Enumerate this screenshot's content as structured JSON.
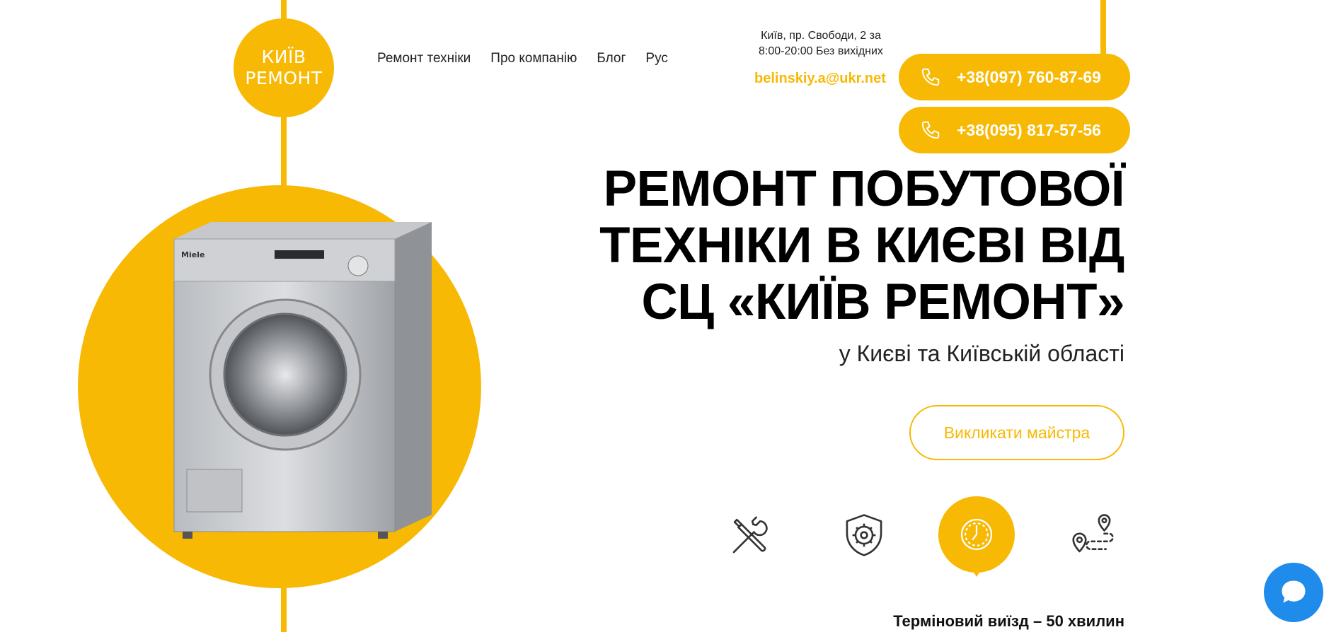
{
  "colors": {
    "accent": "#f7b904",
    "chat": "#1f8ceb",
    "text": "#222222"
  },
  "logo": {
    "line1": "КИЇВ",
    "line2": "РЕМОНТ"
  },
  "nav": {
    "items": [
      {
        "label": "Ремонт техніки"
      },
      {
        "label": "Про компанію"
      },
      {
        "label": "Блог"
      },
      {
        "label": "Рус"
      }
    ]
  },
  "contact": {
    "address": "Київ, пр. Свободи, 2 за",
    "hours": "8:00-20:00 Без вихідних",
    "email": "belinskiy.a@ukr.net",
    "phones": [
      "+38(097) 760-87-69",
      "+38(095) 817-57-56"
    ],
    "phone_icon": "phone-icon"
  },
  "hero": {
    "headline_lines": [
      "РЕМОНТ ПОБУТОВОЇ",
      "ТЕХНІКИ В КИЄВІ ВІД",
      "СЦ «КИЇВ РЕМОНТ»"
    ],
    "subtitle": "у Києві та Київській області",
    "cta_label": "Викликати майстра",
    "image_brand": "Miele"
  },
  "features": {
    "icons": [
      "tools-icon",
      "shield-gear-icon",
      "clock-icon",
      "route-pin-icon"
    ],
    "active_index": 2,
    "caption": "Терміновий виїзд – 50 хвилин"
  },
  "chat": {
    "icon": "chat-bubble-icon"
  }
}
